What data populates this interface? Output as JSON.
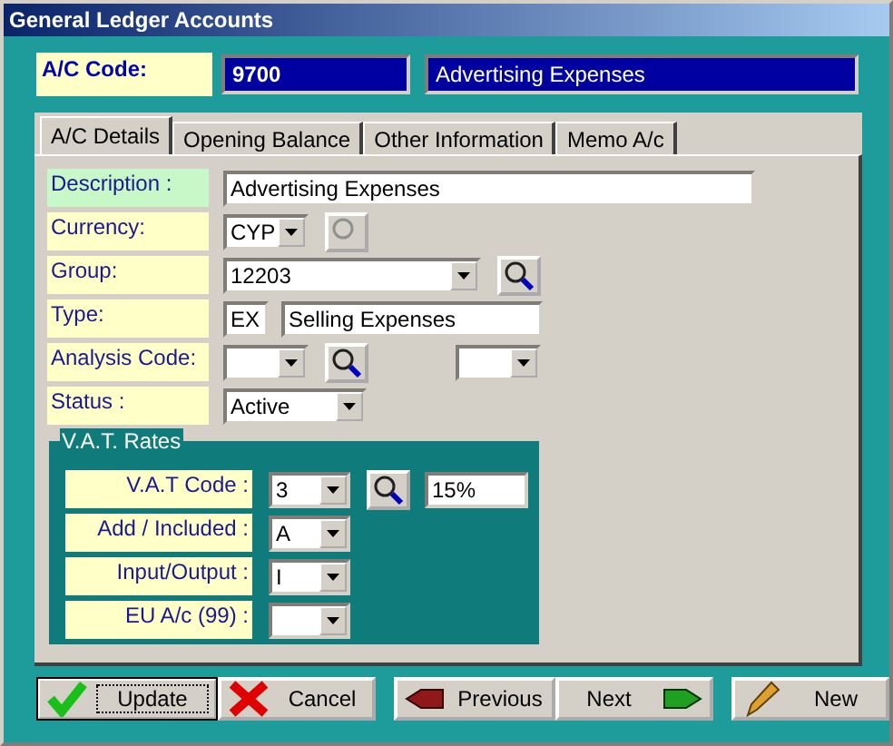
{
  "window": {
    "title": "General Ledger Accounts"
  },
  "account": {
    "label": "A/C Code:",
    "code": "9700",
    "name": "Advertising Expenses"
  },
  "tabs": [
    {
      "label": "A/C Details",
      "selected": true
    },
    {
      "label": "Opening Balance",
      "selected": false
    },
    {
      "label": "Other Information",
      "selected": false
    },
    {
      "label": "Memo A/c",
      "selected": false
    }
  ],
  "fields": [
    {
      "kind": "text",
      "label": "Description :",
      "value": "Advertising Expenses",
      "highlight": true
    },
    {
      "kind": "currency",
      "label": "Currency:",
      "value": "CYP",
      "lookup_disabled": true,
      "highlight": false
    },
    {
      "kind": "group",
      "label": "Group:",
      "value": "12203",
      "highlight": false
    },
    {
      "kind": "type",
      "label": "Type:",
      "value": "EX",
      "description": "Selling Expenses",
      "highlight": false
    },
    {
      "kind": "analysis",
      "label": "Analysis Code:",
      "highlight": false
    },
    {
      "kind": "status",
      "label": "Status :",
      "value": "Active",
      "highlight": false
    }
  ],
  "vat": {
    "title": "V.A.T. Rates",
    "rows": [
      {
        "kind": "lookup",
        "label": "V.A.T Code :",
        "value": "3",
        "rate": "15%"
      },
      {
        "kind": "combo",
        "label": "Add / Included :",
        "value": "A"
      },
      {
        "kind": "combo",
        "label": "Input/Output :",
        "value": "I"
      },
      {
        "kind": "combo",
        "label": "EU A/c (99) :"
      }
    ]
  },
  "buttons": [
    {
      "kind": "check",
      "label": "Update",
      "focused": true
    },
    {
      "kind": "cross",
      "label": "Cancel",
      "focused": false
    },
    {
      "kind": "previous",
      "label": "Previous",
      "focused": false
    },
    {
      "kind": "next",
      "label": "Next",
      "focused": false
    },
    {
      "kind": "pencil",
      "label": "New",
      "focused": false
    }
  ]
}
